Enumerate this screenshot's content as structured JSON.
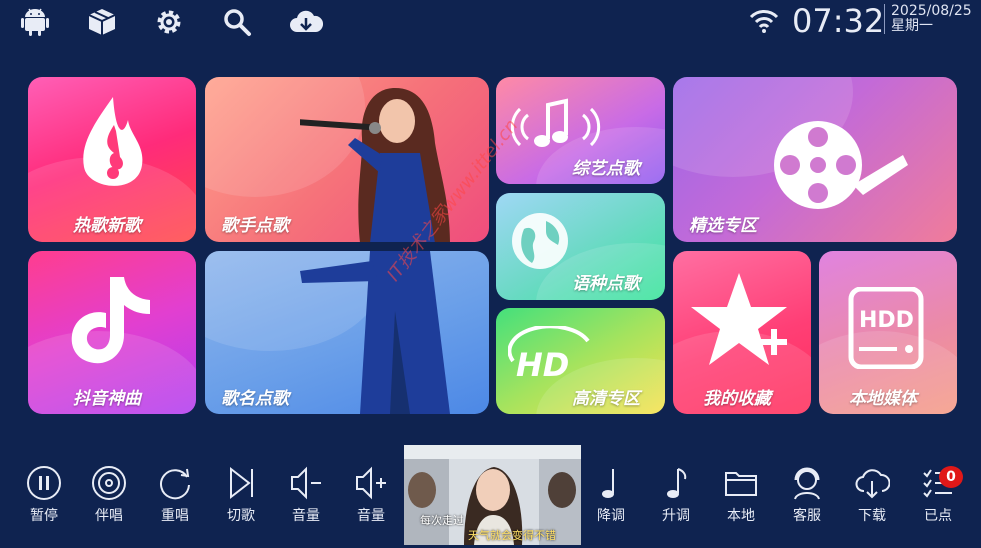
{
  "status": {
    "time": "07:32",
    "date": "2025/08/25",
    "weekday": "星期一"
  },
  "top_icons": [
    "android-icon",
    "package-icon",
    "gear-icon",
    "search-icon",
    "cloud-download-icon",
    "wifi-icon"
  ],
  "tiles": {
    "hot": "热歌新歌",
    "singer": "歌手点歌",
    "variety": "综艺点歌",
    "featured": "精选专区",
    "language": "语种点歌",
    "douyin": "抖音神曲",
    "songname": "歌名点歌",
    "hd": "高清专区",
    "favorites": "我的收藏",
    "local_media": "本地媒体"
  },
  "watermark": "IT技术之家www.ittel.cn",
  "controls": {
    "pause": "暂停",
    "accompany": "伴唱",
    "replay": "重唱",
    "skip": "切歌",
    "vol_down": "音量",
    "vol_up": "音量",
    "pitch_down": "降调",
    "pitch_up": "升调",
    "local": "本地",
    "service": "客服",
    "download": "下载",
    "queued": "已点"
  },
  "queued_count": "0",
  "video": {
    "subtitle_top": "每次走过",
    "subtitle_bottom": "天气就会变得不错"
  },
  "colors": {
    "background": "#0f2350",
    "badge": "#e01818"
  }
}
